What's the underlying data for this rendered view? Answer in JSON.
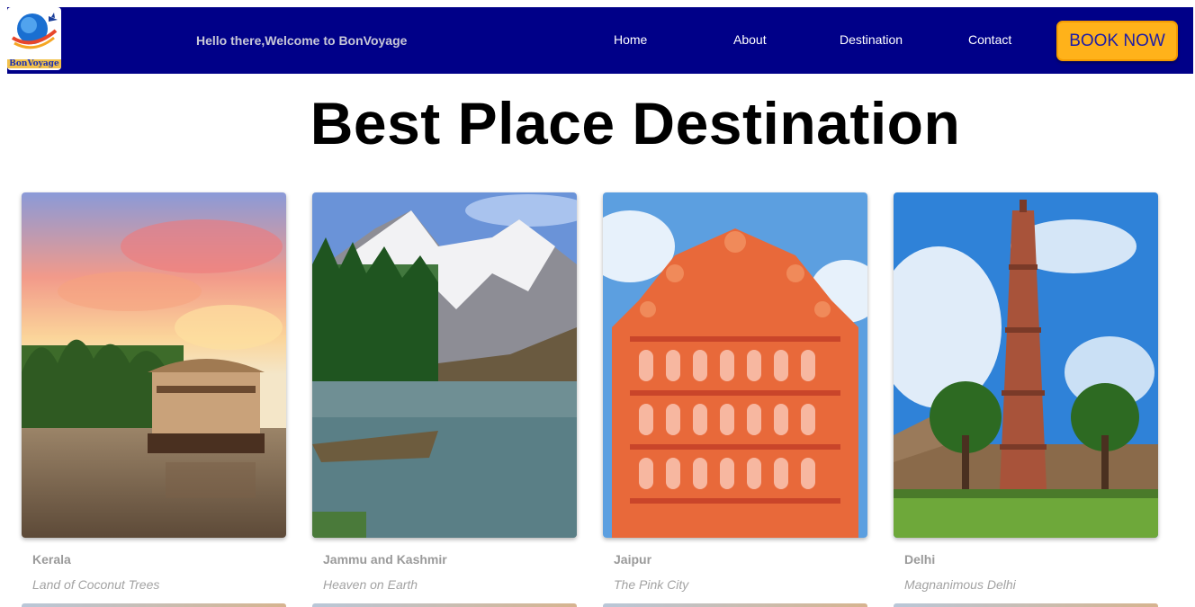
{
  "header": {
    "logo_text": "BonVoyage",
    "welcome": "Hello there,Welcome to BonVoyage",
    "nav": [
      {
        "label": "Home"
      },
      {
        "label": "About"
      },
      {
        "label": "Destination"
      },
      {
        "label": "Contact"
      }
    ],
    "book_label": "BOOK NOW"
  },
  "main": {
    "title": "Best Place Destination",
    "destinations": [
      {
        "name": "Kerala",
        "tagline": "Land of Coconut Trees"
      },
      {
        "name": "Jammu and Kashmir",
        "tagline": "Heaven on Earth"
      },
      {
        "name": "Jaipur",
        "tagline": "The Pink City"
      },
      {
        "name": "Delhi",
        "tagline": "Magnanimous Delhi"
      }
    ]
  },
  "colors": {
    "navbar_bg": "#000088",
    "book_button": "#ffb21a",
    "book_text": "#1d1da8",
    "caption_text": "#9a9a9a"
  },
  "icons": [
    "globe-logo-icon",
    "airplane-icon"
  ]
}
